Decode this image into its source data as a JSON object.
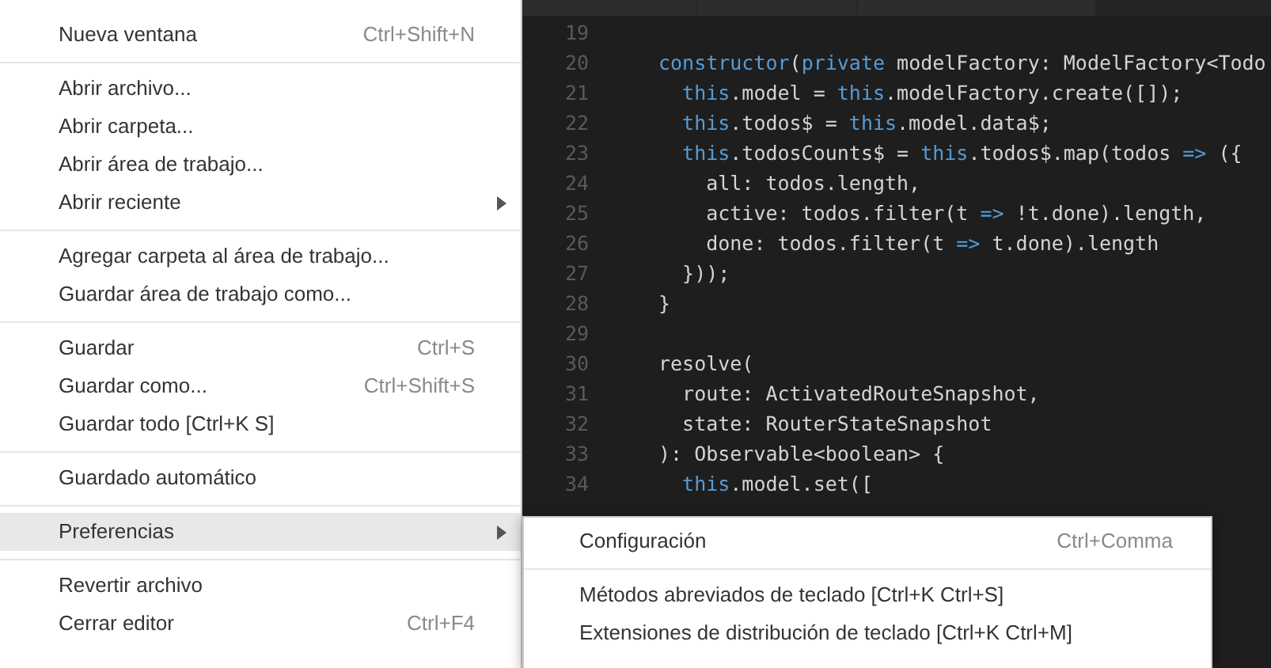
{
  "menu": {
    "groups": [
      [
        {
          "label": "Nueva ventana",
          "shortcut": "Ctrl+Shift+N",
          "submenu": false,
          "selected": false
        }
      ],
      [
        {
          "label": "Abrir archivo...",
          "submenu": false,
          "selected": false
        },
        {
          "label": "Abrir carpeta...",
          "submenu": false,
          "selected": false
        },
        {
          "label": "Abrir área de trabajo...",
          "submenu": false,
          "selected": false
        },
        {
          "label": "Abrir reciente",
          "submenu": true,
          "selected": false
        }
      ],
      [
        {
          "label": "Agregar carpeta al área de trabajo...",
          "submenu": false,
          "selected": false
        },
        {
          "label": "Guardar área de trabajo como...",
          "submenu": false,
          "selected": false
        }
      ],
      [
        {
          "label": "Guardar",
          "shortcut": "Ctrl+S",
          "submenu": false,
          "selected": false
        },
        {
          "label": "Guardar como...",
          "shortcut": "Ctrl+Shift+S",
          "submenu": false,
          "selected": false
        },
        {
          "label": "Guardar todo [Ctrl+K S]",
          "submenu": false,
          "selected": false
        }
      ],
      [
        {
          "label": "Guardado automático",
          "submenu": false,
          "selected": false
        }
      ],
      [
        {
          "label": "Preferencias",
          "submenu": true,
          "selected": true
        }
      ],
      [
        {
          "label": "Revertir archivo",
          "submenu": false,
          "selected": false
        },
        {
          "label": "Cerrar editor",
          "shortcut": "Ctrl+F4",
          "submenu": false,
          "selected": false
        }
      ]
    ]
  },
  "editor": {
    "lines": [
      {
        "number": "19"
      },
      {
        "number": "20",
        "tokens": [
          {
            "kind": "keyword",
            "text": "constructor"
          },
          {
            "kind": "text",
            "text": "("
          },
          {
            "kind": "keyword",
            "text": "private"
          },
          {
            "kind": "text",
            "text": " modelFactory: ModelFactory<Todo"
          }
        ]
      },
      {
        "number": "21",
        "tokens": [
          {
            "kind": "keyword",
            "text": "  this"
          },
          {
            "kind": "text",
            "text": ".model = "
          },
          {
            "kind": "keyword",
            "text": "this"
          },
          {
            "kind": "text",
            "text": ".modelFactory.create([]);"
          }
        ]
      },
      {
        "number": "22",
        "tokens": [
          {
            "kind": "keyword",
            "text": "  this"
          },
          {
            "kind": "text",
            "text": ".todos$ = "
          },
          {
            "kind": "keyword",
            "text": "this"
          },
          {
            "kind": "text",
            "text": ".model.data$;"
          }
        ]
      },
      {
        "number": "23",
        "tokens": [
          {
            "kind": "keyword",
            "text": "  this"
          },
          {
            "kind": "text",
            "text": ".todosCounts$ = "
          },
          {
            "kind": "keyword",
            "text": "this"
          },
          {
            "kind": "text",
            "text": ".todos$.map(todos "
          },
          {
            "kind": "keyword",
            "text": "=>"
          },
          {
            "kind": "text",
            "text": " ({"
          }
        ]
      },
      {
        "number": "24",
        "tokens": [
          {
            "kind": "text",
            "text": "    all: todos.length,"
          }
        ]
      },
      {
        "number": "25",
        "tokens": [
          {
            "kind": "text",
            "text": "    active: todos.filter(t "
          },
          {
            "kind": "keyword",
            "text": "=>"
          },
          {
            "kind": "text",
            "text": " !t.done).length,"
          }
        ]
      },
      {
        "number": "26",
        "tokens": [
          {
            "kind": "text",
            "text": "    done: todos.filter(t "
          },
          {
            "kind": "keyword",
            "text": "=>"
          },
          {
            "kind": "text",
            "text": " t.done).length"
          }
        ]
      },
      {
        "number": "27",
        "tokens": [
          {
            "kind": "text",
            "text": "  }));"
          }
        ]
      },
      {
        "number": "28",
        "tokens": [
          {
            "kind": "text",
            "text": "}"
          }
        ]
      },
      {
        "number": "29"
      },
      {
        "number": "30",
        "tokens": [
          {
            "kind": "text",
            "text": "resolve("
          }
        ]
      },
      {
        "number": "31",
        "tokens": [
          {
            "kind": "text",
            "text": "  route: ActivatedRouteSnapshot,"
          }
        ]
      },
      {
        "number": "32",
        "tokens": [
          {
            "kind": "text",
            "text": "  state: RouterStateSnapshot"
          }
        ]
      },
      {
        "number": "33",
        "tokens": [
          {
            "kind": "text",
            "text": "): Observable<boolean> {"
          }
        ]
      },
      {
        "number": "34",
        "tokens": [
          {
            "kind": "keyword",
            "text": "  this"
          },
          {
            "kind": "text",
            "text": ".model.set(["
          }
        ]
      }
    ]
  },
  "submenu": {
    "groups": [
      [
        {
          "label": "Configuración",
          "shortcut": "Ctrl+Comma",
          "selected": false
        }
      ],
      [
        {
          "label": "Métodos abreviados de teclado [Ctrl+K Ctrl+S]",
          "selected": false
        },
        {
          "label": "Extensiones de distribución de teclado [Ctrl+K Ctrl+M]",
          "selected": false
        }
      ]
    ]
  }
}
